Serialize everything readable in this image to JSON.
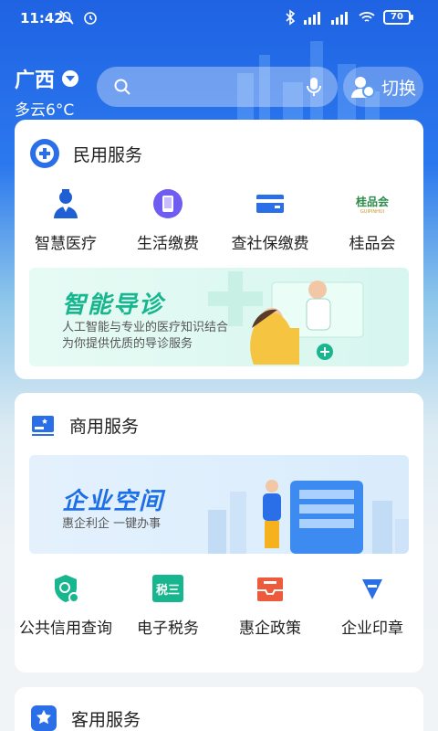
{
  "status_bar": {
    "time": "11:42",
    "battery": "70"
  },
  "location": {
    "city": "广西",
    "weather": "多云6°C"
  },
  "search": {
    "placeholder": ""
  },
  "switch_button": {
    "label": "切换"
  },
  "civil_services": {
    "title": "民用服务",
    "items": [
      {
        "label": "智慧医疗",
        "icon": "doctor-icon"
      },
      {
        "label": "生活缴费",
        "icon": "phone-payment-icon"
      },
      {
        "label": "查社保缴费",
        "icon": "card-icon"
      },
      {
        "label": "桂品会",
        "icon": "guipinhui-logo"
      }
    ],
    "logo_text": "桂品会",
    "logo_subtext": "GUIPINHUI",
    "banner": {
      "title": "智能导诊",
      "line1": "人工智能与专业的医疗知识结合",
      "line2": "为你提供优质的导诊服务"
    }
  },
  "business_services": {
    "title": "商用服务",
    "banner": {
      "title": "企业空间",
      "subtitle": "惠企利企 一键办事"
    },
    "items": [
      {
        "label": "公共信用查询",
        "icon": "credit-shield-icon"
      },
      {
        "label": "电子税务",
        "icon": "tax-icon",
        "icon_text": "税三"
      },
      {
        "label": "惠企政策",
        "icon": "policy-tray-icon"
      },
      {
        "label": "企业印章",
        "icon": "seal-icon"
      }
    ]
  },
  "guest_services": {
    "title": "客用服务"
  },
  "colors": {
    "primary": "#2a6fe8",
    "green": "#17b68e",
    "red": "#ee5a3c"
  }
}
